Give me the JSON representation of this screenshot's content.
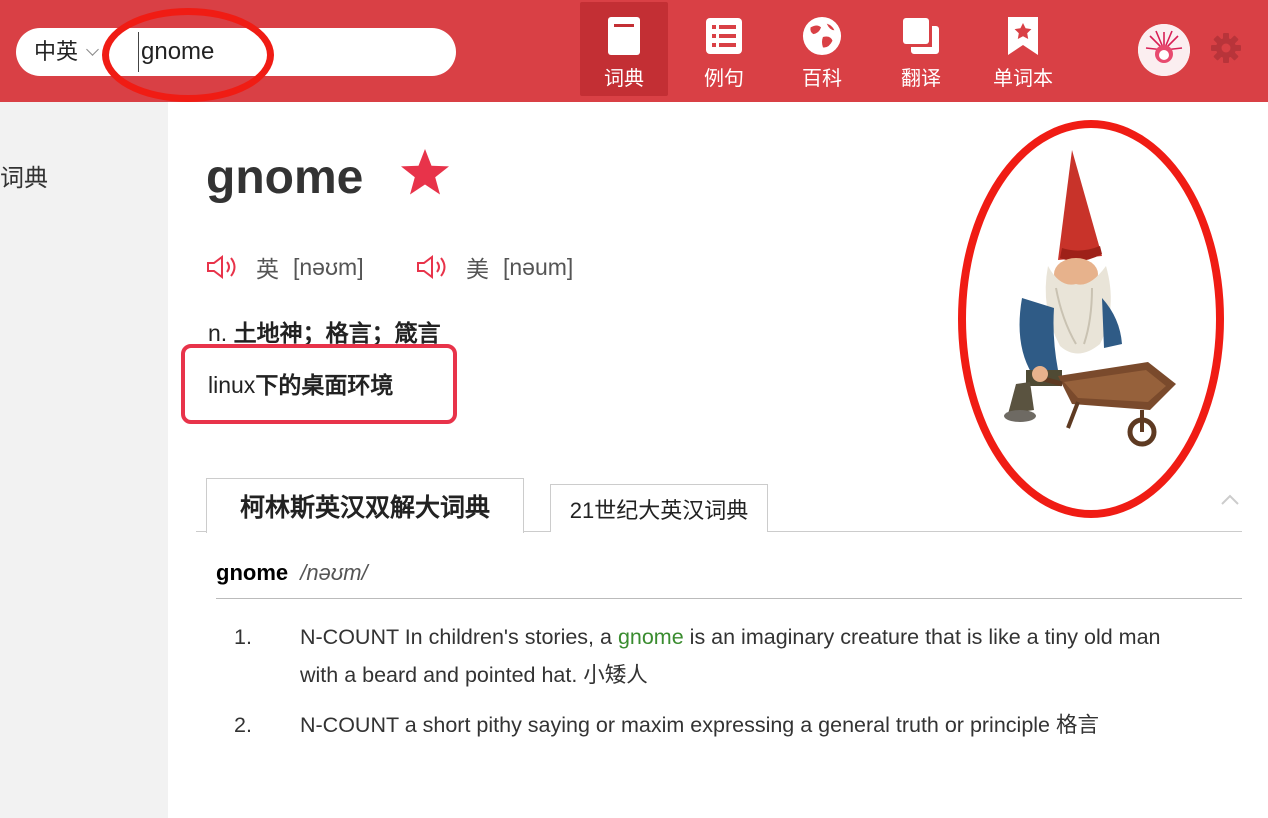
{
  "header": {
    "lang": "中英",
    "search_value": "gnome",
    "nav": [
      {
        "label": "词典",
        "icon": "dictionary-book-icon",
        "active": true
      },
      {
        "label": "例句",
        "icon": "list-icon",
        "active": false
      },
      {
        "label": "百科",
        "icon": "globe-icon",
        "active": false
      },
      {
        "label": "翻译",
        "icon": "copy-pages-icon",
        "active": false
      },
      {
        "label": "单词本",
        "icon": "bookmark-star-icon",
        "active": false
      }
    ]
  },
  "sidebar": {
    "item": "词典"
  },
  "word": {
    "title": "gnome",
    "uk_label": "英",
    "uk_ipa": "[nəʊm]",
    "us_label": "美",
    "us_ipa": "[nəum]",
    "pos": "n.",
    "basic_def": "土地神；格言；箴言",
    "web_def_en": "linux",
    "web_def_cn": "下的桌面环境"
  },
  "dict_tabs": [
    "柯林斯英汉双解大词典",
    "21世纪大英汉词典"
  ],
  "entry": {
    "headword": "gnome",
    "ipa": "/nəʊm/",
    "senses": [
      {
        "num": "1.",
        "tag": "N-COUNT",
        "pre": " In children's stories, a ",
        "hl": "gnome",
        "post": " is an imaginary creature that is like a tiny old man with a beard and pointed hat. 小矮人"
      },
      {
        "num": "2.",
        "tag": "N-COUNT",
        "pre": " a short pithy saying or maxim expressing a general truth or principle 格言",
        "hl": "",
        "post": ""
      }
    ]
  },
  "colors": {
    "header": "#d94045",
    "accent": "#e8334a",
    "annotation": "#f01c14",
    "highlight": "#3a8c2f"
  }
}
